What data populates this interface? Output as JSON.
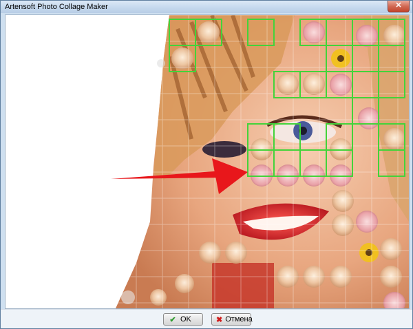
{
  "window": {
    "title": "Artensoft Photo Collage Maker",
    "close_glyph": "✕"
  },
  "preview": {
    "description_icon": "photo-mosaic-image",
    "highlight_color": "#43d33a",
    "arrow_color": "#e8171b"
  },
  "buttons": {
    "ok": {
      "label": "OK",
      "icon": "check-icon",
      "glyph": "✔"
    },
    "cancel": {
      "label": "Отмена",
      "icon": "cross-icon",
      "glyph": "✖"
    }
  }
}
